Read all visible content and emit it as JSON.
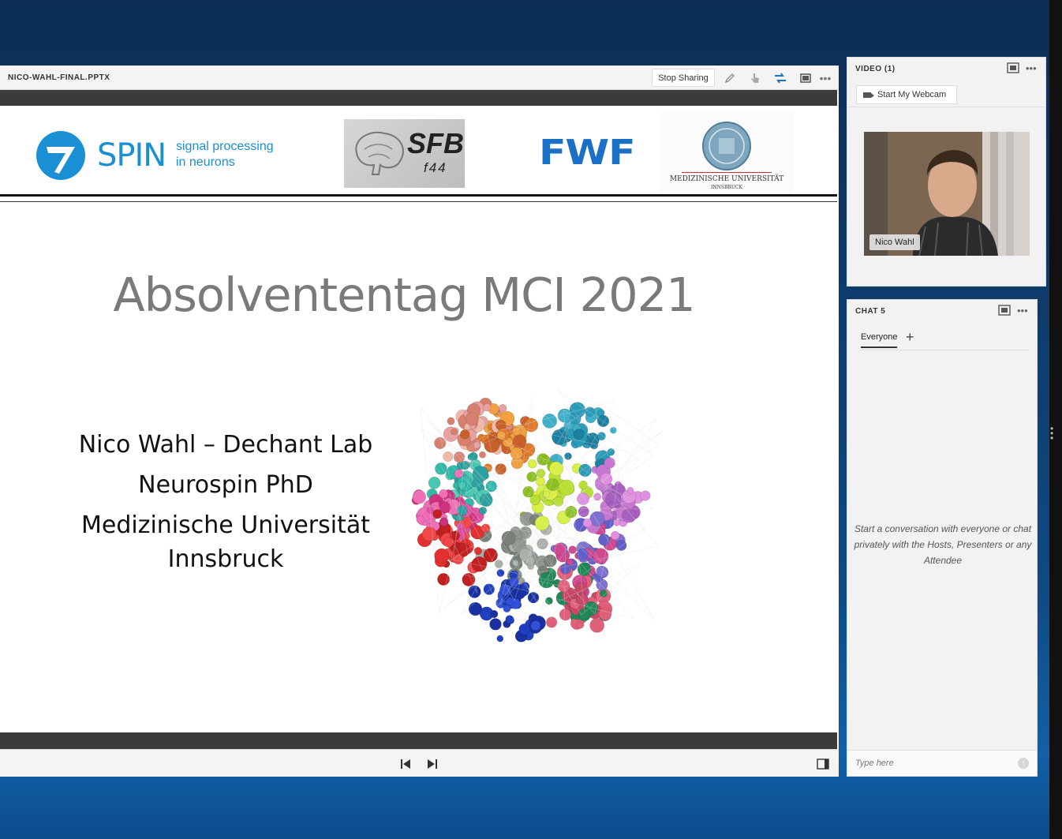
{
  "share_pod": {
    "title": "NICO-WAHL-FINAL.PPTX",
    "stop_sharing_label": "Stop Sharing",
    "icons": [
      "pen-icon",
      "pointer-icon",
      "sync-icon",
      "fullscreen-icon",
      "more-icon"
    ]
  },
  "slide": {
    "logos": {
      "spin_main": "SPIN",
      "spin_sub1": "signal processing",
      "spin_sub2": "in neurons",
      "sfb_main": "SFB",
      "sfb_sub": "f44",
      "fwf": "FWF",
      "mui_line1": "MEDIZINISCHE UNIVERSITÄT",
      "mui_line2": "INNSBRUCK"
    },
    "title": "Absolvententag MCI 2021",
    "author_lines": [
      "Nico Wahl – Dechant Lab",
      "Neurospin PhD",
      "Medizinische Universität",
      "Innsbruck"
    ]
  },
  "video_pod": {
    "title": "VIDEO (1)",
    "webcam_button": "Start My Webcam",
    "participant_name": "Nico Wahl"
  },
  "chat_pod": {
    "title": "CHAT 5",
    "tab_label": "Everyone",
    "tab_add": "+",
    "empty_message": "Start a conversation with everyone or chat privately with the Hosts, Presenters or any Attendee",
    "input_placeholder": "Type here"
  },
  "colors": {
    "spin_blue": "#1b8fd3",
    "background_blue": "#0e4a84"
  }
}
